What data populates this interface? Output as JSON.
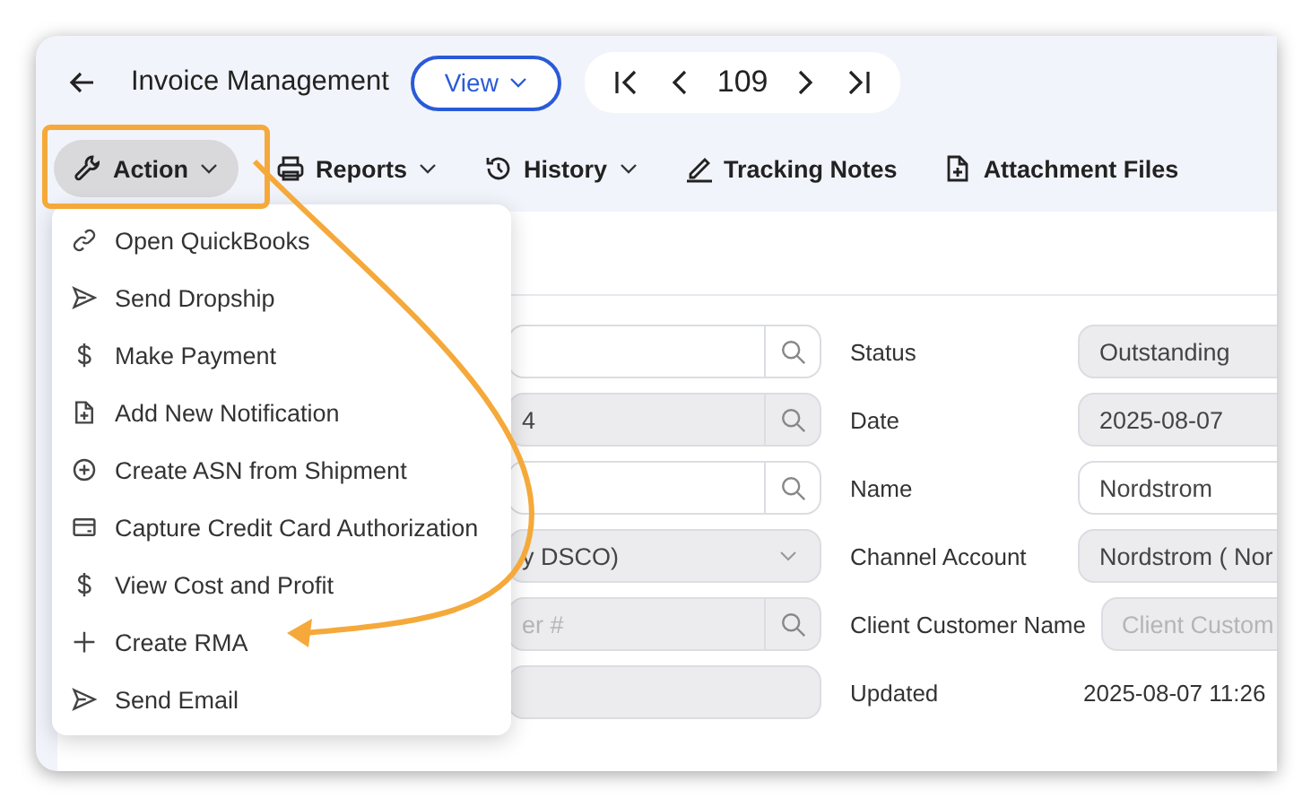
{
  "window": {
    "title": "Invoice Management"
  },
  "view_button": {
    "label": "View"
  },
  "pager": {
    "page": "109"
  },
  "toolbar": [
    {
      "label": "Action",
      "selected": true
    },
    {
      "label": "Reports",
      "selected": false
    },
    {
      "label": "History",
      "selected": false
    },
    {
      "label": "Tracking Notes",
      "selected": false
    },
    {
      "label": "Attachment Files",
      "selected": false
    }
  ],
  "action_menu": {
    "items": [
      {
        "label": "Open QuickBooks"
      },
      {
        "label": "Send Dropship"
      },
      {
        "label": "Make Payment"
      },
      {
        "label": "Add New Notification"
      },
      {
        "label": "Create ASN from Shipment"
      },
      {
        "label": "Capture Credit Card Authorization"
      },
      {
        "label": "View Cost and Profit"
      },
      {
        "label": "Create RMA"
      },
      {
        "label": "Send Email"
      }
    ]
  },
  "form": {
    "left_fields": [
      {
        "kind": "search",
        "disabled": false
      },
      {
        "kind": "search",
        "value": "4",
        "disabled": true
      },
      {
        "kind": "search",
        "disabled": false
      },
      {
        "kind": "select",
        "value": "y DSCO)",
        "disabled": true
      },
      {
        "kind": "search",
        "placeholder": "er #",
        "disabled": true
      },
      {
        "kind": "text",
        "disabled": true
      }
    ],
    "right_fields": [
      {
        "label": "Status",
        "kind": "text",
        "value": "Outstanding",
        "disabled": true
      },
      {
        "label": "Date",
        "kind": "text",
        "value": "2025-08-07",
        "disabled": true
      },
      {
        "label": "Name",
        "kind": "text",
        "value": "Nordstrom",
        "disabled": false
      },
      {
        "label": "Channel Account",
        "kind": "text",
        "value": "Nordstrom ( Nor",
        "disabled": true
      },
      {
        "label": "Client Customer Name",
        "kind": "text",
        "placeholder": "Client Custom",
        "disabled": true
      },
      {
        "label": "Updated",
        "kind": "plain",
        "value": "2025-08-07 11:26"
      }
    ]
  }
}
